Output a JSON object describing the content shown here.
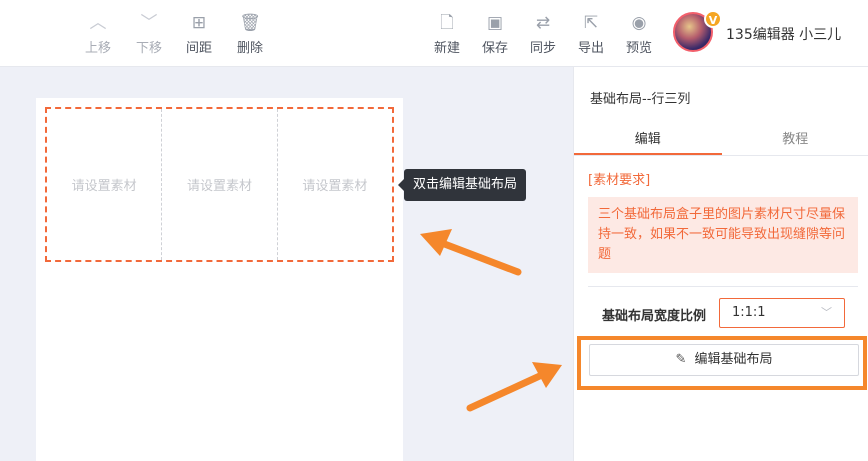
{
  "toolbar": {
    "up": {
      "label": "上移",
      "icon": "chevron-up-icon"
    },
    "down": {
      "label": "下移",
      "icon": "chevron-down-icon"
    },
    "spacing": {
      "label": "间距",
      "icon": "grid-icon"
    },
    "delete": {
      "label": "删除",
      "icon": "trash-icon"
    },
    "new": {
      "label": "新建",
      "icon": "document-icon"
    },
    "save": {
      "label": "保存",
      "icon": "save-icon"
    },
    "sync": {
      "label": "同步",
      "icon": "sync-icon"
    },
    "export": {
      "label": "导出",
      "icon": "export-icon"
    },
    "preview": {
      "label": "预览",
      "icon": "eye-icon"
    }
  },
  "user": {
    "name": "135编辑器 小三儿",
    "badge": "V"
  },
  "editor": {
    "cells": [
      "请设置素材",
      "请设置素材",
      "请设置素材"
    ],
    "tooltip": "双击编辑基础布局",
    "accent_color": "#f2693a"
  },
  "panel": {
    "title": "基础布局--行三列",
    "tabs": [
      {
        "label": "编辑"
      },
      {
        "label": "教程"
      }
    ],
    "requirement_label": "[素材要求]",
    "requirement_text": "三个基础布局盒子里的图片素材尺寸尽量保持一致，如果不一致可能导致出现缝隙等问题",
    "ratio_label": "基础布局宽度比例",
    "ratio_value": "1:1:1",
    "edit_button_label": "编辑基础布局"
  },
  "annotation_color": "#f5872b"
}
